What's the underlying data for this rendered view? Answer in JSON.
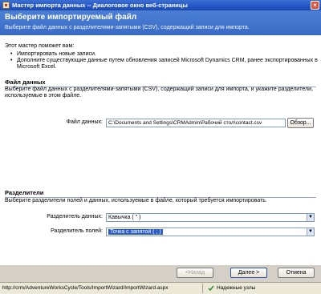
{
  "window": {
    "title": "Мастер импорта данных -- Диалоговое окно веб-страницы",
    "close_glyph": "×"
  },
  "header": {
    "heading": "Выберите импортируемый файл",
    "subheading": "Выберите файл данных с разделителями-запятыми (CSV), содержащий записи для импорта."
  },
  "intro": {
    "lead": "Этот мастер поможет вам:",
    "items": [
      "Импортировать новые записи.",
      "Дополните существующие данные путем обновления записей Microsoft Dynamics  CRM, ранее экспортированных в Microsoft Excel."
    ]
  },
  "data_file": {
    "title": "Файл данных",
    "description": "Выберите файл данных с разделителями-запятыми (CSV), содержащий записи для импорта, и укажите разделители, используемые в этом файле.",
    "field_label": "Файл данных:",
    "field_value": "C:\\Documents and Settings\\CRMAdmin\\Рабочий стол\\contact.csv",
    "browse_label": "Обзор..."
  },
  "delimiters": {
    "title": "Разделители",
    "description": "Выберите разделители полей и данных, используемые в файле, который требуется импортировать.",
    "data_label": "Разделитель данных:",
    "data_value": "Кавычка ( \" )",
    "field_label": "Разделитель полей:",
    "field_value": "Точка с запятой ( ; )"
  },
  "buttons": {
    "back": "<Назад",
    "next": "Далее >",
    "cancel": "Отмена"
  },
  "statusbar": {
    "url": "http://crm/AdventureWorksCycle/Tools/ImportWizard/ImportWizard.aspx",
    "zone": "Надежные узлы"
  },
  "colors": {
    "accent": "#3a6bc4",
    "selection": "#2b5cc6"
  }
}
